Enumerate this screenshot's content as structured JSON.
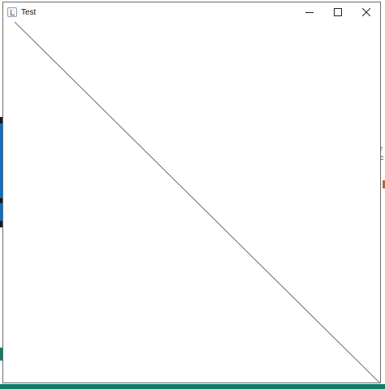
{
  "window": {
    "title": "Test",
    "app_icon": "java-cup-icon",
    "controls": {
      "minimize_icon": "minimize-icon",
      "maximize_icon": "maximize-icon",
      "close_icon": "close-icon"
    }
  },
  "canvas": {
    "background": "#ffffff",
    "line_color": "#4a4a4a"
  },
  "background_fragments": {
    "right_text": "r\nc"
  }
}
